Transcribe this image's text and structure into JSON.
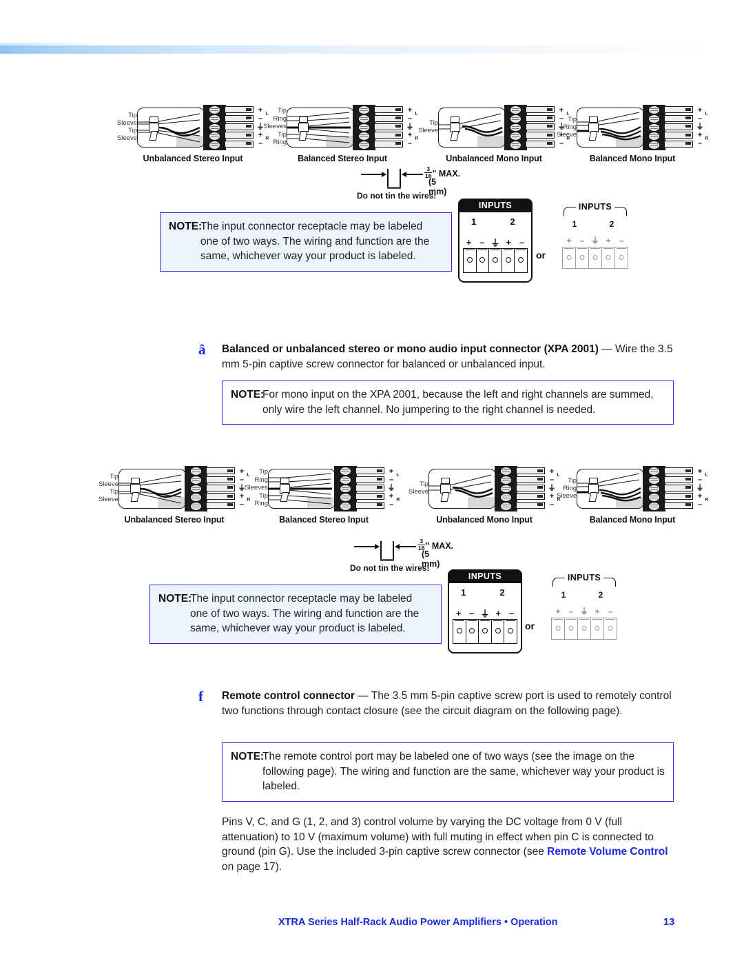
{
  "page": {
    "number": "13",
    "footer_title": "XTRA Series Half-Rack Audio Power Amplifiers • Operation",
    "footer_separator": "•"
  },
  "connector_labels": {
    "tip": "Tip",
    "ring": "Ring",
    "sleeve": "Sleeve",
    "sleeves": "Sleeves",
    "plus": "+",
    "minus": "–",
    "ground": "⏚",
    "channel_left": "L",
    "channel_right": "R"
  },
  "diagram_groups": [
    {
      "id": "group-1",
      "diagrams": [
        {
          "caption": "Unbalanced Stereo Input",
          "wire_labels": [
            "Tip",
            "Sleeve",
            "Tip",
            "Sleeve"
          ],
          "pin_polarity": [
            "+",
            "–",
            "⏚",
            "+",
            "–"
          ]
        },
        {
          "caption": "Balanced Stereo Input",
          "wire_labels": [
            "Tip",
            "Ring",
            "Sleeves",
            "Tip",
            "Ring"
          ],
          "pin_polarity": [
            "+",
            "–",
            "⏚",
            "+",
            "–"
          ]
        },
        {
          "caption": "Unbalanced Mono Input",
          "wire_labels": [
            "Tip",
            "Sleeve"
          ],
          "pin_polarity": [
            "+",
            "–",
            "⏚",
            "+",
            "–"
          ]
        },
        {
          "caption": "Balanced Mono Input",
          "wire_labels": [
            "Tip",
            "Ring",
            "Sleeve"
          ],
          "pin_polarity": [
            "+",
            "–",
            "⏚",
            "+",
            "–"
          ]
        }
      ],
      "strip_spec": {
        "numerator": "3",
        "denominator": "16",
        "inch_mark": "\"",
        "max_label": "MAX.",
        "metric": "(5 mm)",
        "warning": "Do not tin the wires!"
      },
      "receptacles": {
        "dark": {
          "title": "INPUTS",
          "channel_numbers": [
            "1",
            "2"
          ],
          "polarity": [
            "+",
            "–",
            "⏚",
            "+",
            "–"
          ]
        },
        "or_label": "or",
        "light": {
          "title": "INPUTS",
          "channel_numbers": [
            "1",
            "2"
          ],
          "polarity": [
            "+",
            "–",
            "⏚",
            "+",
            "–"
          ]
        }
      },
      "note": {
        "lead": "NOTE:",
        "text": "The input connector receptacle may be labeled one of two ways. The wiring and function are the same, whichever way your product is labeled."
      }
    },
    {
      "id": "group-2",
      "diagrams": [
        {
          "caption": "Unbalanced Stereo Input",
          "wire_labels": [
            "Tip",
            "Sleeve",
            "Tip",
            "Sleeve"
          ],
          "pin_polarity": [
            "+",
            "–",
            "⏚",
            "+",
            "–"
          ]
        },
        {
          "caption": "Balanced Stereo Input",
          "wire_labels": [
            "Tip",
            "Ring",
            "Sleeves",
            "Tip",
            "Ring"
          ],
          "pin_polarity": [
            "+",
            "–",
            "⏚",
            "+",
            "–"
          ]
        },
        {
          "caption": "Unbalanced Mono Input",
          "wire_labels": [
            "Tip",
            "Sleeve"
          ],
          "pin_polarity": [
            "+",
            "–",
            "⏚",
            "+",
            "–"
          ]
        },
        {
          "caption": "Balanced Mono Input",
          "wire_labels": [
            "Tip",
            "Ring",
            "Sleeve"
          ],
          "pin_polarity": [
            "+",
            "–",
            "⏚",
            "+",
            "–"
          ]
        }
      ],
      "strip_spec": {
        "numerator": "3",
        "denominator": "16",
        "inch_mark": "\"",
        "max_label": "MAX.",
        "metric": "(5 mm)",
        "warning": "Do not tin the wires!"
      },
      "receptacles": {
        "dark": {
          "title": "INPUTS",
          "channel_numbers": [
            "1",
            "2"
          ],
          "polarity": [
            "+",
            "–",
            "⏚",
            "+",
            "–"
          ]
        },
        "or_label": "or",
        "light": {
          "title": "INPUTS",
          "channel_numbers": [
            "1",
            "2"
          ],
          "polarity": [
            "+",
            "–",
            "⏚",
            "+",
            "–"
          ]
        }
      },
      "note": {
        "lead": "NOTE:",
        "text": "The input connector receptacle may be labeled one of two ways. The wiring and function are the same, whichever way your product is labeled."
      }
    }
  ],
  "sections": [
    {
      "id": "section-a",
      "bullet": "â",
      "heading": "Balanced or unbalanced stereo or mono audio input connector (XPA 2001)",
      "dash": " — ",
      "body": "Wire the 3.5 mm 5-pin captive screw connector for balanced or unbalanced input."
    },
    {
      "id": "section-f",
      "bullet": "f",
      "heading": "Remote control connector",
      "dash": " — ",
      "body": "The 3.5 mm 5-pin captive screw port is used to remotely control two functions through contact closure (see the circuit diagram on the following page)."
    }
  ],
  "notes": {
    "mono_note": {
      "lead": "NOTE:",
      "text": "For mono input on the XPA 2001, because the left and right channels are summed, only wire the left channel. No jumpering to the right channel is needed."
    },
    "remote_note": {
      "lead": "NOTE:",
      "text": "The remote control port may be labeled one of two ways (see the image on the following page). The wiring and function are the same, whichever way your product is labeled."
    }
  },
  "closing_paragraph": {
    "text_before": "Pins V, C, and G (1, 2, and 3) control volume by varying the DC voltage from 0 V (full attenuation) to 10 V (maximum volume) with full muting in effect when pin C is connected to ground (pin G). Use the included 3-pin captive screw connector (see ",
    "link": "Remote Volume Control",
    "text_after": " on page 17)."
  },
  "colors": {
    "accent_blue": "#1a2ae0",
    "note_border": "#2a2ae6",
    "note_tint": "#eef4fb",
    "rule_blue": "#8fc4f2",
    "body_text": "#222222"
  }
}
